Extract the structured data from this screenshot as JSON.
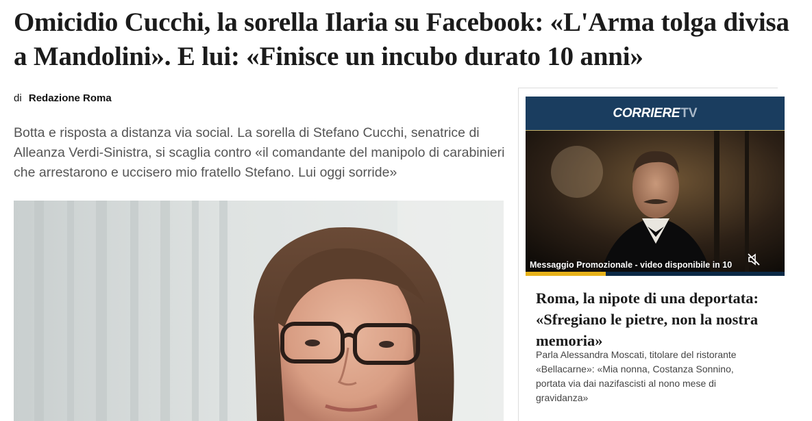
{
  "article": {
    "headline": "Omicidio Cucchi, la sorella Ilaria su Facebook: «L'Arma tolga divisa a Mandolini». E lui: «Finisce un incubo durato 10 anni»",
    "byline_prefix": "di",
    "byline_author": "Redazione Roma",
    "summary": "Botta e risposta a distanza via social. La sorella di Stefano Cucchi, senatrice di Alleanza Verdi-Sinistra, si scaglia contro «il comandante del manipolo di carabinieri che arrestarono e uccisero mio fratello Stefano. Lui oggi sorride»"
  },
  "sidebar": {
    "tv_brand": "CORRIERE",
    "tv_suffix": "TV",
    "tv_caption": "Messaggio Promozionale - video disponibile in 10",
    "tv_progress": 0.31,
    "mute_icon": "speaker-muted-icon",
    "story_title": "Roma, la nipote di una deportata: «Sfregiano le pietre, non la nostra memoria»",
    "story_text": "Parla Alessandra Moscati, titolare del ristorante «Bellacarne»: «Mia nonna, Costanza Sonnino, portata via dai nazifascisti al nono mese di gravidanza»"
  },
  "colors": {
    "tv_header_bg": "#1a3d5f",
    "tv_progress": "#e7b21a",
    "summary_text": "#555555"
  }
}
